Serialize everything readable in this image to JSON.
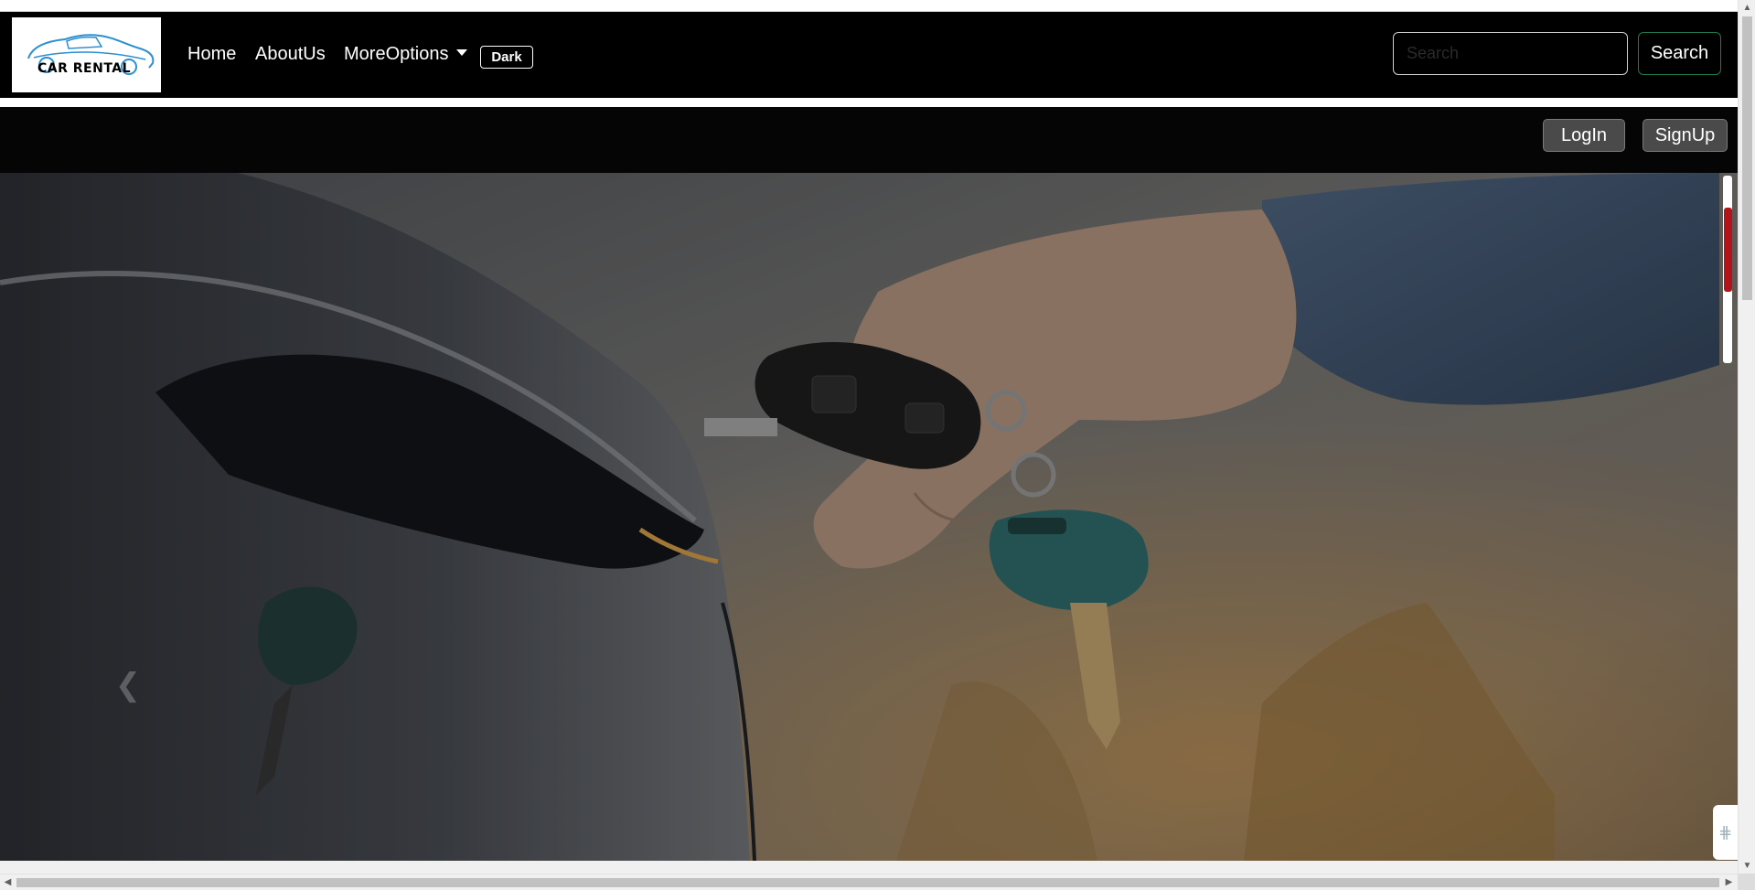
{
  "brand": {
    "logo_text": "CAR RENTAL",
    "logo_icon": "car-logo-icon"
  },
  "navbar": {
    "links": [
      {
        "label": "Home"
      },
      {
        "label": "AboutUs"
      },
      {
        "label": "MoreOptions"
      }
    ],
    "theme_toggle_label": "Dark",
    "search": {
      "placeholder": "Search",
      "value": "",
      "button_label": "Search"
    }
  },
  "subbar": {
    "login_label": "LogIn",
    "signup_label": "SignUp"
  },
  "hero": {
    "image_subject": "hand-holding-car-key-near-car-door",
    "prev_icon": "chevron-left-icon"
  },
  "colors": {
    "navbar_bg": "#000000",
    "subbar_bg": "#050505",
    "search_button_border": "#1f7a4d",
    "scroll_indicator_thumb": "#b3131b"
  }
}
